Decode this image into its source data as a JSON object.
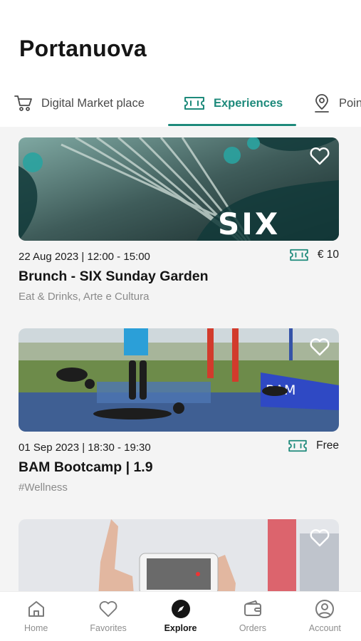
{
  "header": {
    "title": "Portanuova"
  },
  "tabs": [
    {
      "label": "Digital Market place",
      "icon": "cart-icon",
      "active": false
    },
    {
      "label": "Experiences",
      "icon": "ticket-icon",
      "active": true
    },
    {
      "label": "Points",
      "icon": "map-pin-icon",
      "active": false
    }
  ],
  "events": [
    {
      "image_text": "SIX",
      "date": "22 Aug 2023 | 12:00 - 15:00",
      "price": "€ 10",
      "title": "Brunch - SIX Sunday Garden",
      "tags": "Eat & Drinks, Arte e Cultura"
    },
    {
      "image_text": "BAM",
      "date": "01 Sep 2023 | 18:30 - 19:30",
      "price": "Free",
      "title": "BAM Bootcamp | 1.9",
      "tags": "#Wellness"
    }
  ],
  "bottom_nav": {
    "home": "Home",
    "favorites": "Favorites",
    "explore": "Explore",
    "orders": "Orders",
    "account": "Account"
  },
  "colors": {
    "accent": "#1e8a7b",
    "text": "#151515",
    "muted": "#8a8a8a"
  }
}
